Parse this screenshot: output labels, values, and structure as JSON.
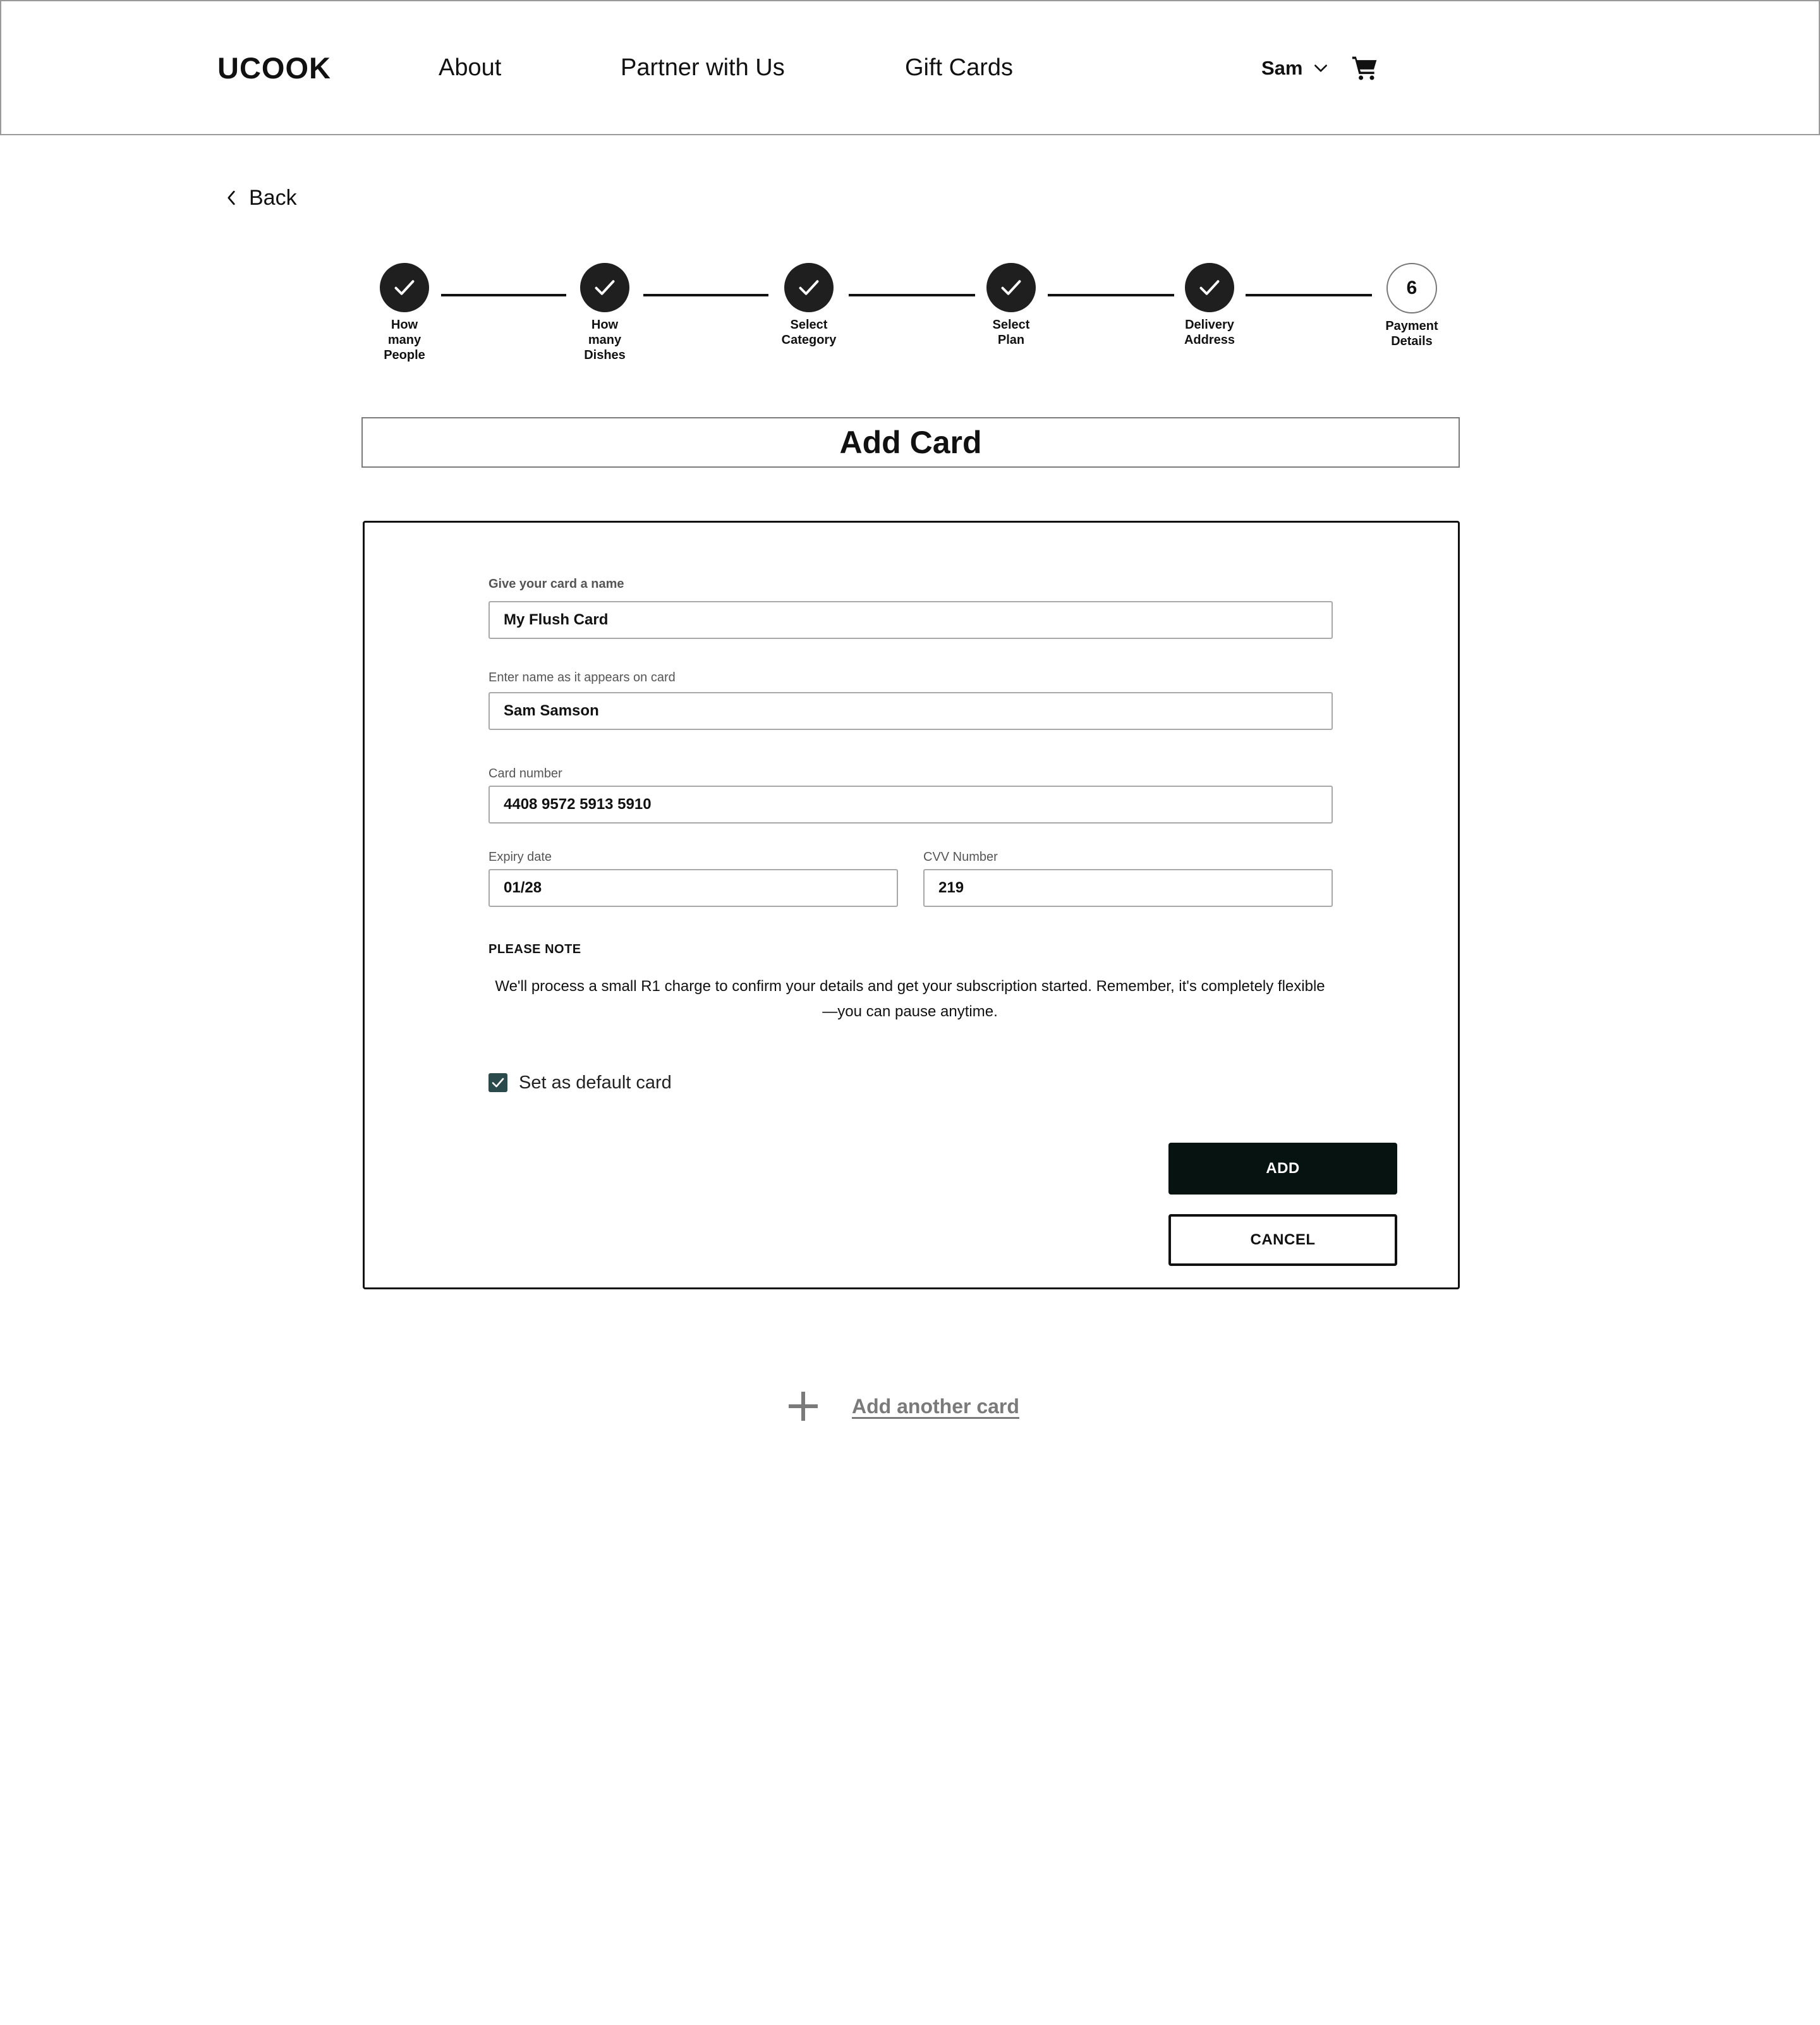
{
  "header": {
    "logo": "UCOOK",
    "nav": {
      "about": "About",
      "partner": "Partner with Us",
      "gift_cards": "Gift Cards"
    },
    "user_name": "Sam",
    "icons": {
      "user_menu": "chevron-down-icon",
      "cart": "cart-icon"
    }
  },
  "back": {
    "label": "Back",
    "icon": "chevron-left-icon"
  },
  "stepper": {
    "steps": [
      {
        "label": "How\nmany\nPeople",
        "state": "complete"
      },
      {
        "label": "How\nmany\nDishes",
        "state": "complete"
      },
      {
        "label": "Select\nCategory",
        "state": "complete"
      },
      {
        "label": "Select\nPlan",
        "state": "complete"
      },
      {
        "label": "Delivery\nAddress",
        "state": "complete"
      },
      {
        "label": "Payment\nDetails",
        "state": "current",
        "number": "6"
      }
    ]
  },
  "title": "Add Card",
  "form": {
    "card_name": {
      "label": "Give your card a name",
      "value": "My Flush Card"
    },
    "holder_name": {
      "label": "Enter name as it appears on card",
      "value": "Sam Samson"
    },
    "card_number": {
      "label": "Card number",
      "value": "4408 9572 5913 5910"
    },
    "expiry": {
      "label": "Expiry date",
      "value": "01/28"
    },
    "cvv": {
      "label": "CVV Number",
      "value": "219"
    },
    "note_title": "PLEASE NOTE",
    "note_text": "We'll process a small R1 charge to confirm your details and get your subscription started. Remember, it's completely flexible—you can pause anytime.",
    "default_card": {
      "label": "Set as default card",
      "checked": true
    },
    "add_label": "ADD",
    "cancel_label": "CANCEL"
  },
  "add_another": {
    "label": "Add another card",
    "icon": "plus-icon"
  },
  "colors": {
    "primary_dark": "#061311",
    "checkbox": "#2b4a4c",
    "step_complete": "#1f1f1f",
    "muted_link": "#7a7a7a"
  }
}
